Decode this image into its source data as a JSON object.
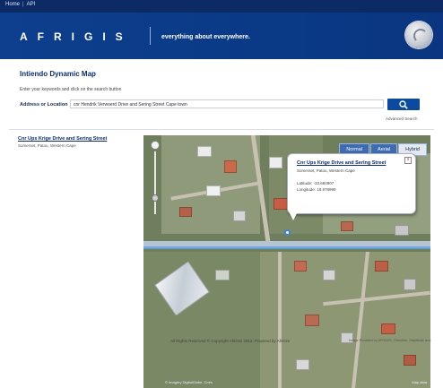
{
  "topbar": {
    "breadcrumb": [
      "Home",
      "API"
    ]
  },
  "banner": {
    "logo": "AFRIGIS",
    "tagline": "everything about everywhere.",
    "globe_icon": "globe-icon"
  },
  "page": {
    "title": "Intiendo Dynamic Map",
    "description": "Enter your keywords and click on the search button",
    "address_label": "Address or Location",
    "address_value": "cnr Hendrik Verwoerd Drive and Sering Street Cape town",
    "search_icon": "search-icon",
    "advanced_search": "Advanced Search"
  },
  "result": {
    "title": "Cnr Ups Krige Drive and Sering Street",
    "subtitle": "Somerset, Patou, Western Cape"
  },
  "map": {
    "tabs": [
      {
        "label": "Normal",
        "active": false
      },
      {
        "label": "Aerial",
        "active": false
      },
      {
        "label": "Hybrid",
        "active": true
      }
    ],
    "popup": {
      "title": "Cnr Ups Krige Drive and Sering Street",
      "subtitle": "Somerset, Patou, Western Cape",
      "latitude": "Latitude: -33.684907",
      "longitude": "Longitude: 18.978999",
      "close": "x"
    },
    "copyright": "© Imagery DigitalGlobe, Cnes",
    "brand": "Map data"
  },
  "footer": {
    "left": "All Rights Reserved © Copyright AfriGIS 2013. Powered by AfriGIS",
    "right": "Image Provided by AFRIGIS. Orientale, Maptitude and"
  },
  "colors": {
    "banner": "#0d3f8e",
    "topbar": "#0c2a64",
    "accent": "#0b4a9e",
    "tab_blue": "#3f6bb0"
  }
}
